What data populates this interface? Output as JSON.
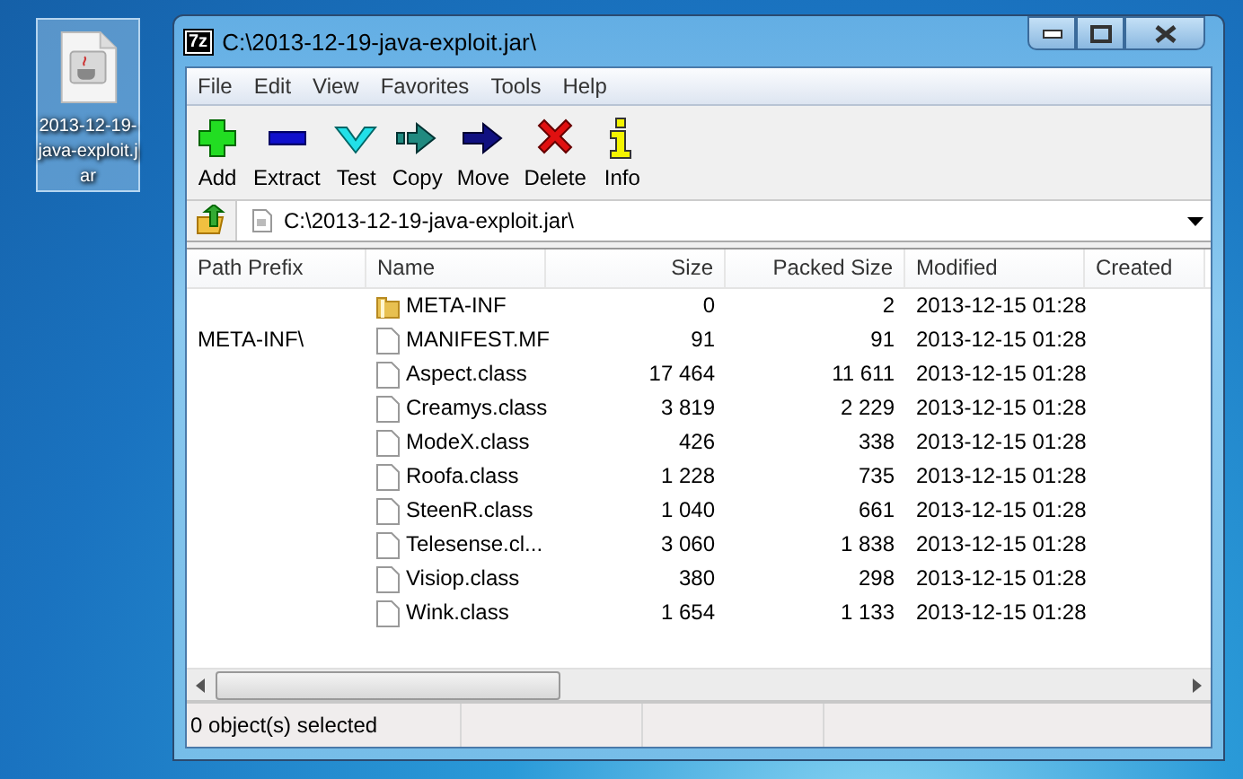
{
  "desktop_icon": {
    "label": "2013-12-19-java-exploit.jar",
    "selected": true
  },
  "window": {
    "logo": "7z",
    "title": "C:\\2013-12-19-java-exploit.jar\\"
  },
  "menu": [
    "File",
    "Edit",
    "View",
    "Favorites",
    "Tools",
    "Help"
  ],
  "toolbar": [
    {
      "kind": "add",
      "label": "Add"
    },
    {
      "kind": "extract",
      "label": "Extract"
    },
    {
      "kind": "test",
      "label": "Test"
    },
    {
      "kind": "copy",
      "label": "Copy"
    },
    {
      "kind": "move",
      "label": "Move"
    },
    {
      "kind": "delete",
      "label": "Delete"
    },
    {
      "kind": "info",
      "label": "Info"
    }
  ],
  "address": {
    "value": "C:\\2013-12-19-java-exploit.jar\\"
  },
  "table": {
    "columns": [
      "Path Prefix",
      "Name",
      "Size",
      "Packed Size",
      "Modified",
      "Created"
    ],
    "rows": [
      {
        "kind": "folder",
        "path_prefix": "",
        "name": "META-INF",
        "size": "0",
        "packed_size": "2",
        "modified": "2013-12-15 01:28"
      },
      {
        "kind": "file",
        "path_prefix": "META-INF\\",
        "name": "MANIFEST.MF",
        "size": "91",
        "packed_size": "91",
        "modified": "2013-12-15 01:28"
      },
      {
        "kind": "file",
        "path_prefix": "",
        "name": "Aspect.class",
        "size": "17 464",
        "packed_size": "11 611",
        "modified": "2013-12-15 01:28"
      },
      {
        "kind": "file",
        "path_prefix": "",
        "name": "Creamys.class",
        "size": "3 819",
        "packed_size": "2 229",
        "modified": "2013-12-15 01:28"
      },
      {
        "kind": "file",
        "path_prefix": "",
        "name": "ModeX.class",
        "size": "426",
        "packed_size": "338",
        "modified": "2013-12-15 01:28"
      },
      {
        "kind": "file",
        "path_prefix": "",
        "name": "Roofa.class",
        "size": "1 228",
        "packed_size": "735",
        "modified": "2013-12-15 01:28"
      },
      {
        "kind": "file",
        "path_prefix": "",
        "name": "SteenR.class",
        "size": "1 040",
        "packed_size": "661",
        "modified": "2013-12-15 01:28"
      },
      {
        "kind": "file",
        "path_prefix": "",
        "name": "Telesense.cl...",
        "size": "3 060",
        "packed_size": "1 838",
        "modified": "2013-12-15 01:28"
      },
      {
        "kind": "file",
        "path_prefix": "",
        "name": "Visiop.class",
        "size": "380",
        "packed_size": "298",
        "modified": "2013-12-15 01:28"
      },
      {
        "kind": "file",
        "path_prefix": "",
        "name": "Wink.class",
        "size": "1 654",
        "packed_size": "1 133",
        "modified": "2013-12-15 01:28"
      }
    ]
  },
  "status_bar": [
    "0 object(s) selected"
  ]
}
